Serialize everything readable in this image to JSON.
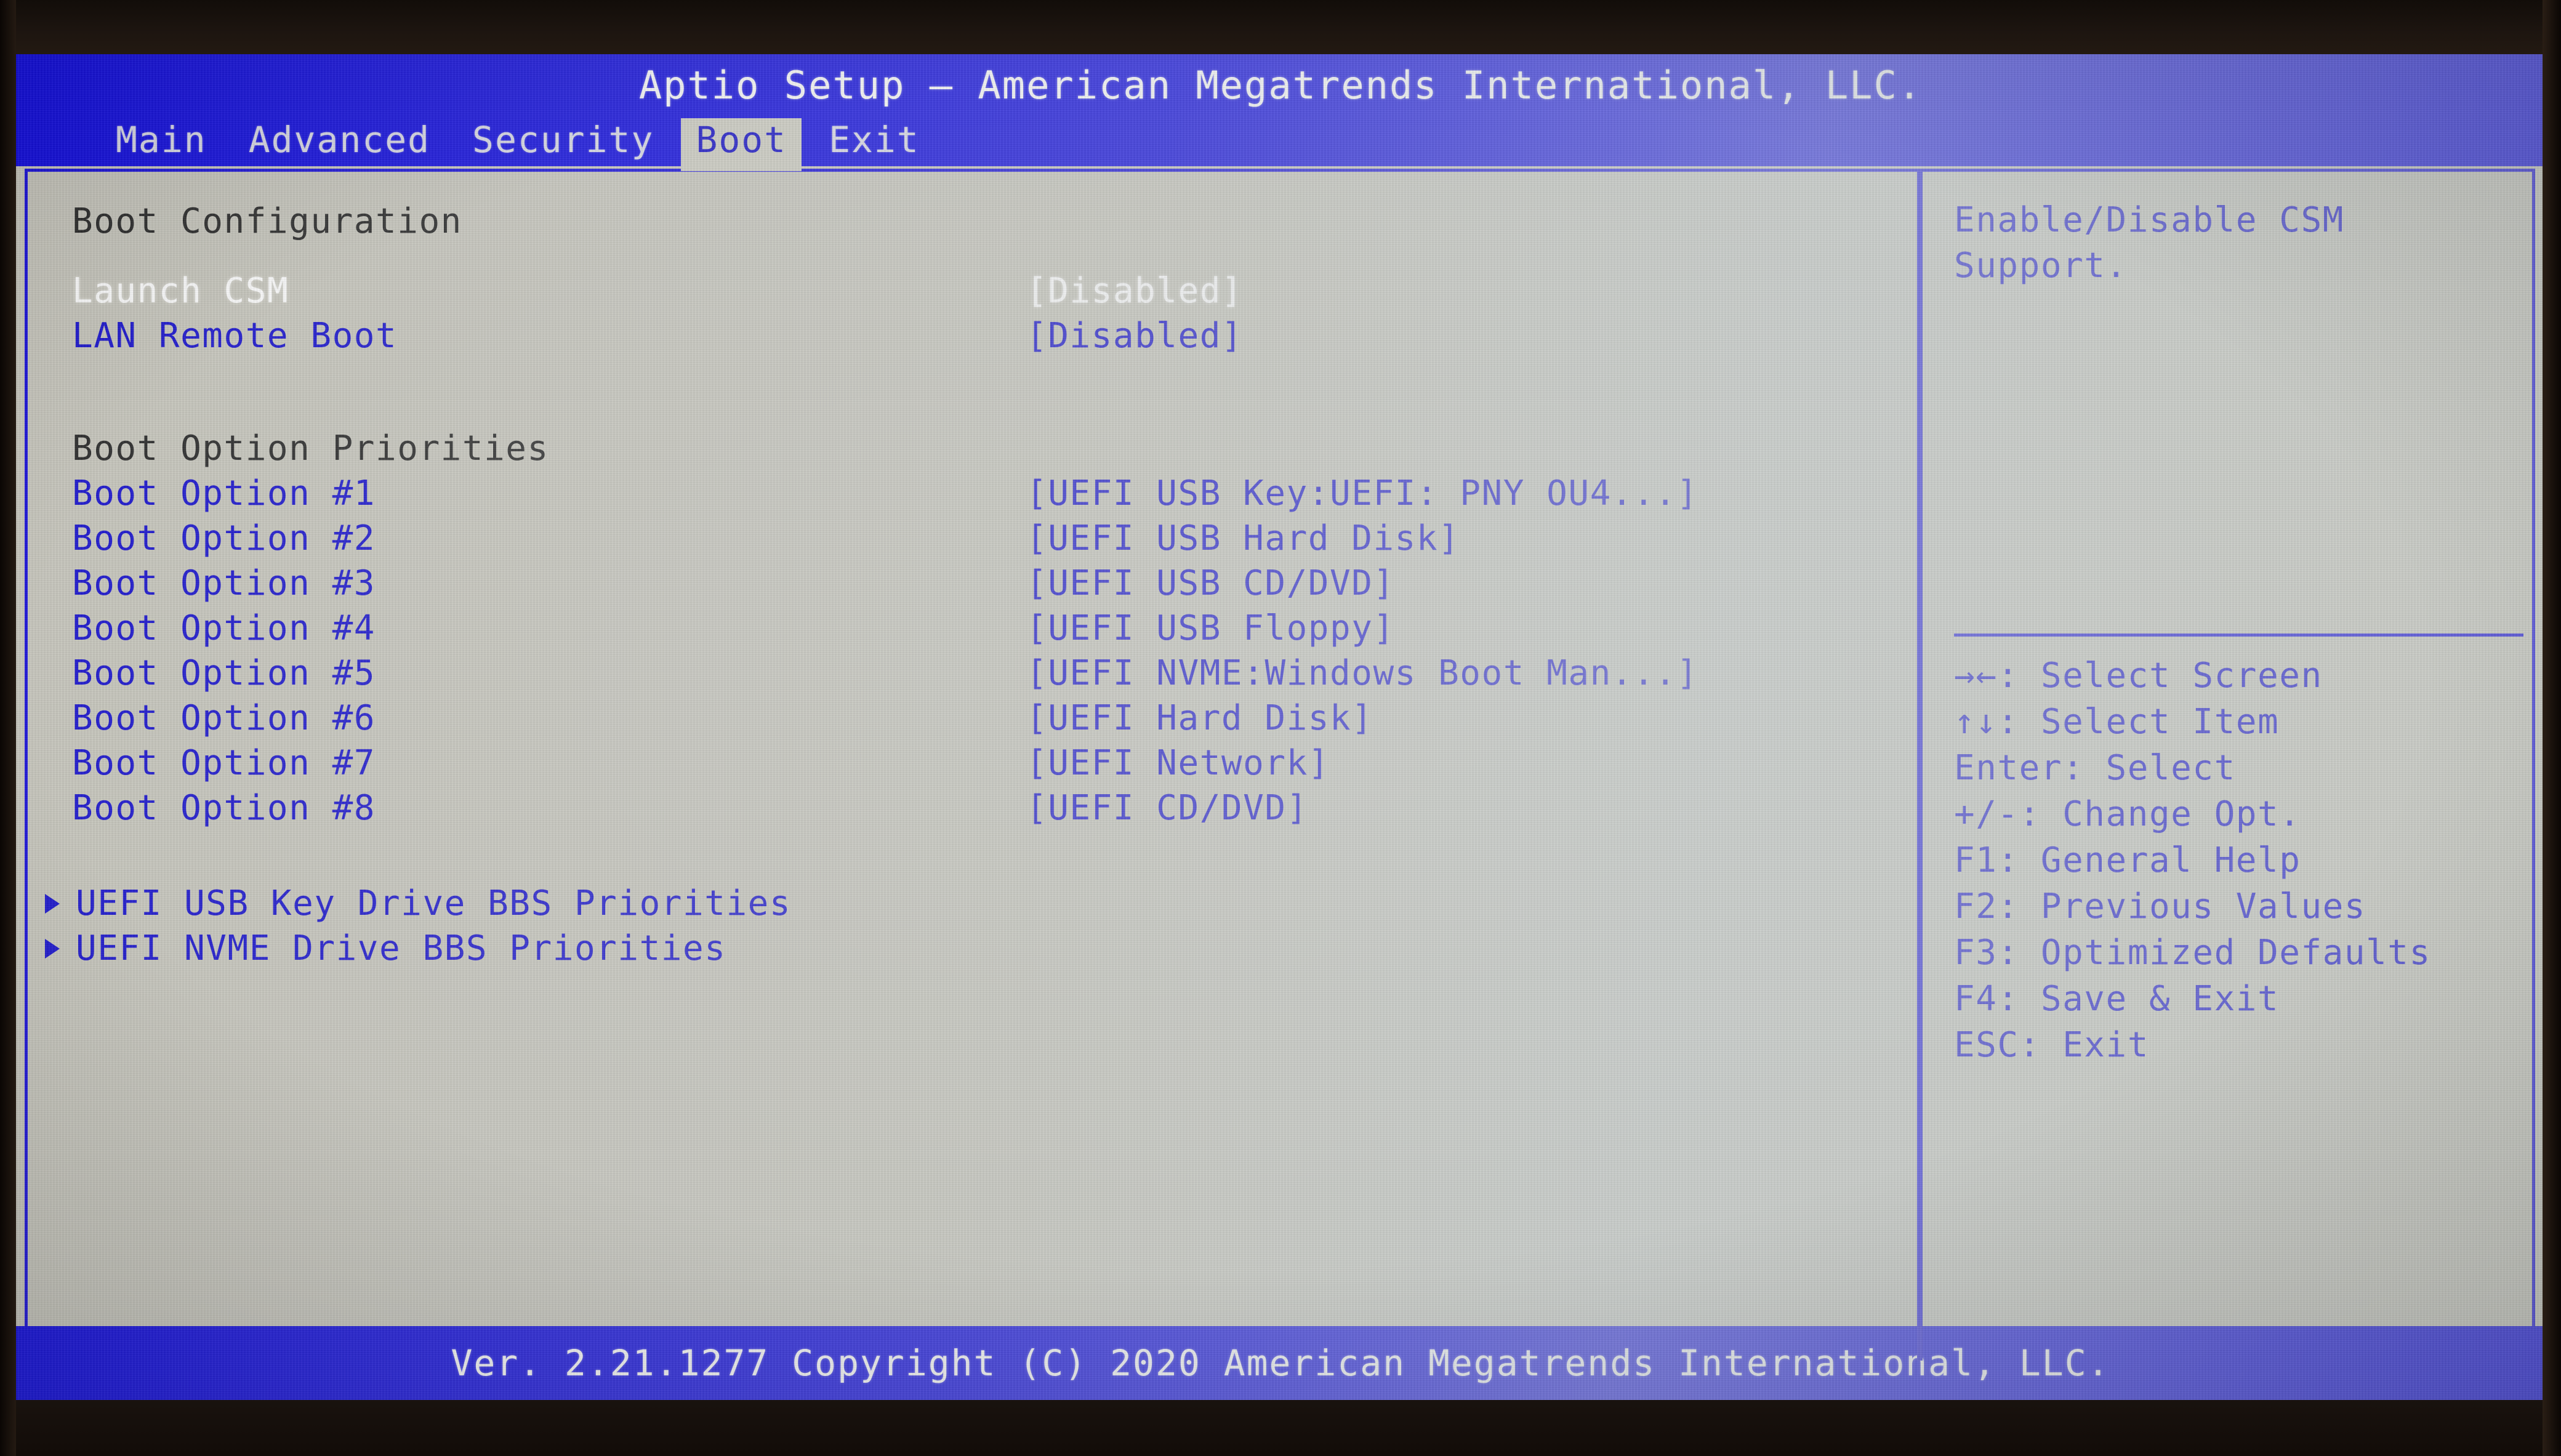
{
  "window": {
    "title": "Aptio Setup – American Megatrends International, LLC."
  },
  "menu": {
    "tabs": [
      {
        "label": "Main",
        "active": false
      },
      {
        "label": "Advanced",
        "active": false
      },
      {
        "label": "Security",
        "active": false
      },
      {
        "label": "Boot",
        "active": true
      },
      {
        "label": "Exit",
        "active": false
      }
    ]
  },
  "main": {
    "section_boot_config": "Boot Configuration",
    "settings": [
      {
        "label": "Launch CSM",
        "value": "[Disabled]",
        "selected": true
      },
      {
        "label": "LAN Remote Boot",
        "value": "[Disabled]",
        "selected": false
      }
    ],
    "section_boot_priorities": "Boot Option Priorities",
    "boot_options": [
      {
        "label": "Boot Option #1",
        "value": "[UEFI USB Key:UEFI: PNY OU4...]"
      },
      {
        "label": "Boot Option #2",
        "value": "[UEFI USB Hard Disk]"
      },
      {
        "label": "Boot Option #3",
        "value": "[UEFI USB CD/DVD]"
      },
      {
        "label": "Boot Option #4",
        "value": "[UEFI USB Floppy]"
      },
      {
        "label": "Boot Option #5",
        "value": "[UEFI NVME:Windows Boot Man...]"
      },
      {
        "label": "Boot Option #6",
        "value": "[UEFI Hard Disk]"
      },
      {
        "label": "Boot Option #7",
        "value": "[UEFI Network]"
      },
      {
        "label": "Boot Option #8",
        "value": "[UEFI CD/DVD]"
      }
    ],
    "submenus": [
      {
        "label": "UEFI USB Key Drive BBS Priorities"
      },
      {
        "label": "UEFI NVME Drive BBS Priorities"
      }
    ]
  },
  "help": {
    "description": "Enable/Disable CSM\nSupport.",
    "legend": [
      {
        "keys": "→←",
        "text": ": Select Screen"
      },
      {
        "keys": "↑↓",
        "text": ": Select Item"
      },
      {
        "keys": "Enter",
        "text": ": Select"
      },
      {
        "keys": "+/-",
        "text": ": Change Opt."
      },
      {
        "keys": "F1",
        "text": ": General Help"
      },
      {
        "keys": "F2",
        "text": ": Previous Values"
      },
      {
        "keys": "F3",
        "text": ": Optimized Defaults"
      },
      {
        "keys": "F4",
        "text": ": Save & Exit"
      },
      {
        "keys": "ESC",
        "text": ": Exit"
      }
    ]
  },
  "footer": {
    "text": "Ver. 2.21.1277 Copyright (C) 2020 American Megatrends International, LLC."
  },
  "colors": {
    "chrome_blue": "#1510e2",
    "text_blue": "#1d17cf",
    "selected_white": "#ffffff",
    "heading_dark": "#2c2c2c",
    "panel_bg": "#c9c8be"
  }
}
